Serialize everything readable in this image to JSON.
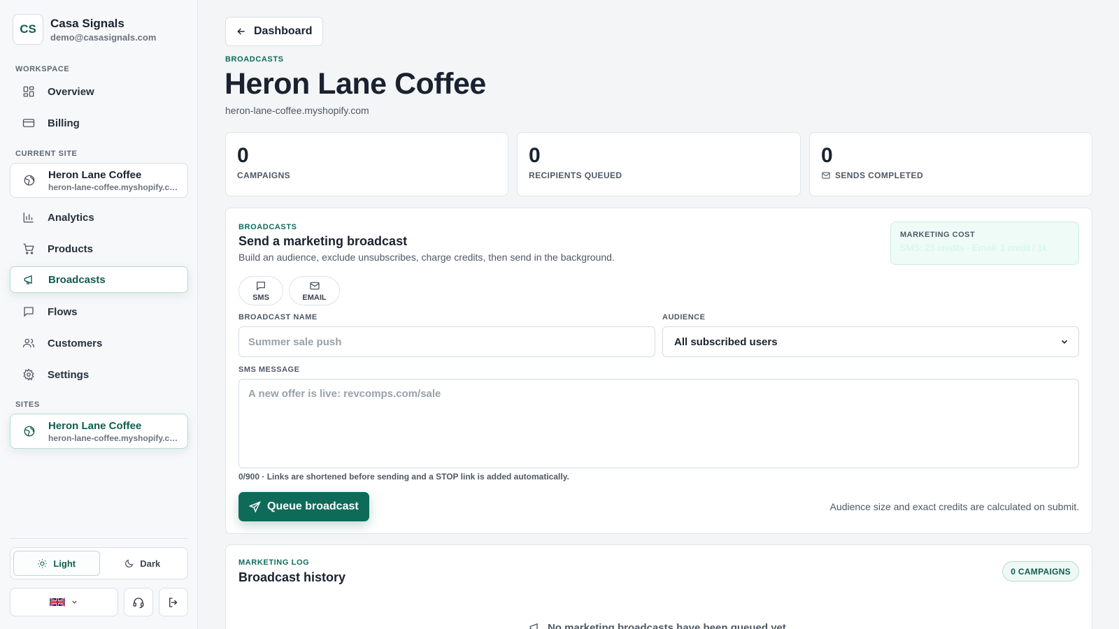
{
  "brand": {
    "initials": "CS",
    "name": "Casa Signals",
    "email": "demo@casasignals.com"
  },
  "sidebar": {
    "workspace_label": "WORKSPACE",
    "workspace_items": [
      {
        "label": "Overview",
        "icon": "grid-icon"
      },
      {
        "label": "Billing",
        "icon": "credit-card-icon"
      }
    ],
    "current_site_label": "CURRENT SITE",
    "current_site": {
      "name": "Heron Lane Coffee",
      "domain": "heron-lane-coffee.myshopify.com"
    },
    "site_items": [
      {
        "label": "Analytics",
        "icon": "bar-chart-icon"
      },
      {
        "label": "Products",
        "icon": "cart-icon"
      },
      {
        "label": "Broadcasts",
        "icon": "megaphone-icon",
        "active": true
      },
      {
        "label": "Flows",
        "icon": "message-square-icon"
      },
      {
        "label": "Customers",
        "icon": "users-icon"
      },
      {
        "label": "Settings",
        "icon": "gear-icon"
      }
    ],
    "sites_label": "SITES",
    "sites": [
      {
        "name": "Heron Lane Coffee",
        "domain": "heron-lane-coffee.myshopify.com"
      }
    ],
    "theme": {
      "light": "Light",
      "dark": "Dark",
      "selected": "Light"
    }
  },
  "header": {
    "back_label": "Dashboard",
    "eyebrow": "BROADCASTS",
    "title": "Heron Lane Coffee",
    "subtitle": "heron-lane-coffee.myshopify.com"
  },
  "stats": [
    {
      "value": "0",
      "label": "CAMPAIGNS"
    },
    {
      "value": "0",
      "label": "RECIPIENTS QUEUED"
    },
    {
      "value": "0",
      "label": "SENDS COMPLETED",
      "icon": "mail-icon"
    }
  ],
  "broadcast": {
    "eyebrow": "BROADCASTS",
    "title": "Send a marketing broadcast",
    "description": "Build an audience, exclude unsubscribes, charge credits, then send in the background.",
    "cost_label": "MARKETING COST",
    "cost_value": "SMS: 25 credits · Email: 1 credit / 1k",
    "channels": [
      {
        "label": "SMS",
        "icon": "message-square-icon"
      },
      {
        "label": "EMAIL",
        "icon": "mail-icon"
      }
    ],
    "name_label": "BROADCAST NAME",
    "name_placeholder": "Summer sale push",
    "name_value": "",
    "audience_label": "AUDIENCE",
    "audience_value": "All subscribed users",
    "message_label": "SMS MESSAGE",
    "message_placeholder": "A new offer is live: revcomps.com/sale",
    "message_value": "",
    "hint": "0/900 · Links are shortened before sending and a STOP link is added automatically.",
    "queue_label": "Queue broadcast",
    "submit_note": "Audience size and exact credits are calculated on submit."
  },
  "history": {
    "eyebrow": "MARKETING LOG",
    "title": "Broadcast history",
    "badge": "0 CAMPAIGNS",
    "empty_text": "No marketing broadcasts have been queued yet."
  },
  "colors": {
    "accent": "#0f6b59",
    "accent_light": "#eef8f4",
    "background": "#f3f5f7",
    "text": "#1a2230"
  }
}
